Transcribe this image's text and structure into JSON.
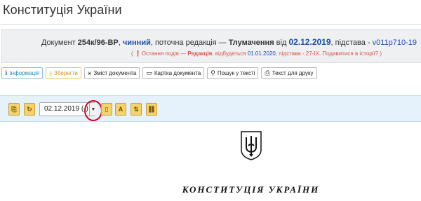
{
  "page": {
    "title": "Конституція України"
  },
  "info": {
    "doc_prefix": "Документ ",
    "doc_number": "254к/96-ВР",
    "sep1": ", ",
    "status": "чинний",
    "current_edition": ", поточна редакція — ",
    "edition_type": "Тлумачення",
    "from_word": " від ",
    "edition_date": "02.12.2019",
    "basis_label": ", підстава - ",
    "basis_link": "v011p710-19",
    "event_open": "( ",
    "event_link": "Остання подія — ",
    "event_type": "Редакція",
    "event_happened": ", відбудеться ",
    "event_date": "01.01.2020",
    "event_basis": ", підстава - 27-IX.",
    "event_history": " Подивитися в історії?",
    "event_close": " )"
  },
  "toolbar": {
    "info_label": "Інформація",
    "save_label": "Зберегти",
    "contents_label": "Зміст документа",
    "card_label": "Картка документа",
    "search_label": "Пошук у тексті",
    "print_label": "Текст для друку"
  },
  "navigation": {
    "date_value": "02.12.2019 (-)",
    "dropdown_arrow": "▼"
  },
  "document": {
    "heading": "КОНСТИТУЦІЯ УКРАЇНИ"
  },
  "colors": {
    "link_blue": "#1b4fa3",
    "event_red": "#d9534f",
    "nav_bg": "#e6f2fb",
    "highlight": "#d0021b"
  }
}
